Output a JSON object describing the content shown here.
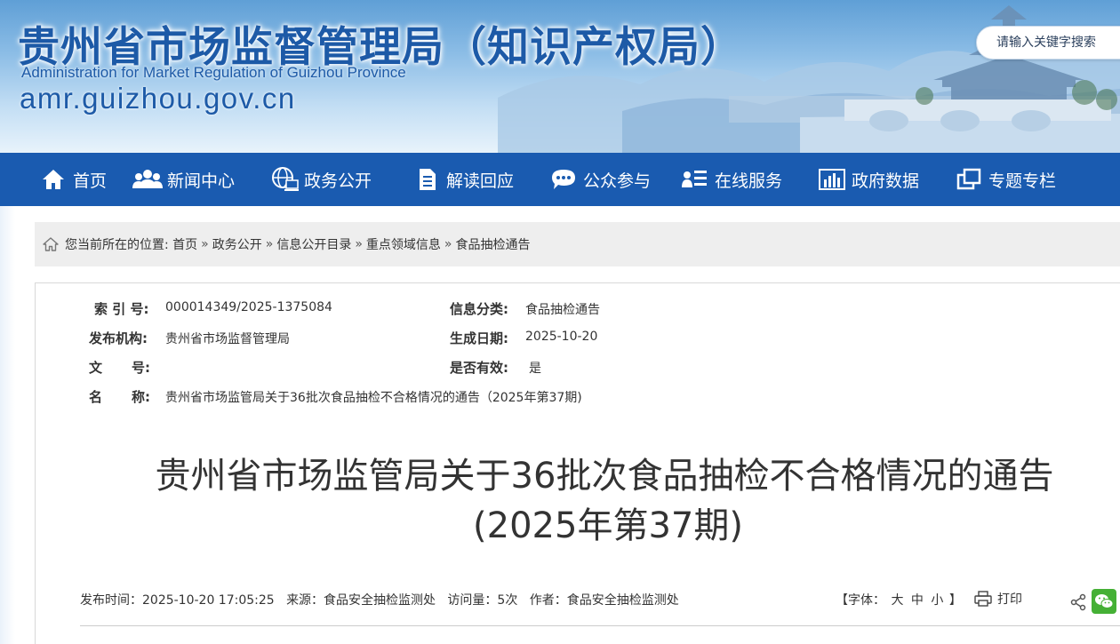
{
  "header": {
    "title": "贵州省市场监督管理局（知识产权局）",
    "subtitle": "Administration for Market Regulation of Guizhou Province",
    "domain": "amr.guizhou.gov.cn",
    "search_placeholder": "请输入关键字搜索"
  },
  "nav": {
    "items": [
      {
        "label": "首页",
        "icon": "home-icon"
      },
      {
        "label": "新闻中心",
        "icon": "people-icon"
      },
      {
        "label": "政务公开",
        "icon": "globe-computer-icon"
      },
      {
        "label": "解读回应",
        "icon": "document-icon"
      },
      {
        "label": "公众参与",
        "icon": "chat-bubble-icon"
      },
      {
        "label": "在线服务",
        "icon": "user-list-icon"
      },
      {
        "label": "政府数据",
        "icon": "bar-chart-icon"
      },
      {
        "label": "专题专栏",
        "icon": "windows-icon"
      }
    ],
    "color": "#1a5bb0"
  },
  "breadcrumb": {
    "prefix": "您当前所在的位置:",
    "items": [
      "首页",
      "政务公开",
      "信息公开目录",
      "重点领域信息",
      "食品抽检通告"
    ],
    "separator": "»"
  },
  "meta": {
    "index_label": "索 引 号:",
    "index_value": "000014349/2025-1375084",
    "category_label": "信息分类:",
    "category_value": "食品抽检通告",
    "publisher_label": "发布机构:",
    "publisher_value": "贵州省市场监督管理局",
    "date_label": "生成日期:",
    "date_value": "2025-10-20",
    "docno_label_a": "文",
    "docno_label_b": "号:",
    "docno_value": "",
    "valid_label": "是否有效:",
    "valid_value": "是",
    "name_label_a": "名",
    "name_label_b": "称:",
    "name_value": "贵州省市场监管局关于36批次食品抽检不合格情况的通告（2025年第37期)"
  },
  "document": {
    "title_line1": "贵州省市场监管局关于36批次食品抽检不合格情况的通告",
    "title_line2": "(2025年第37期)"
  },
  "info": {
    "publish_time": "发布时间：2025-10-20 17:05:25",
    "source": "来源：食品安全抽检监测处",
    "views": "访问量：5次",
    "author": "作者：食品安全抽检监测处",
    "font_label": "【字体：",
    "font_large": "大",
    "font_medium": "中",
    "font_small": "小",
    "font_close": "】",
    "print_label": "打印"
  }
}
